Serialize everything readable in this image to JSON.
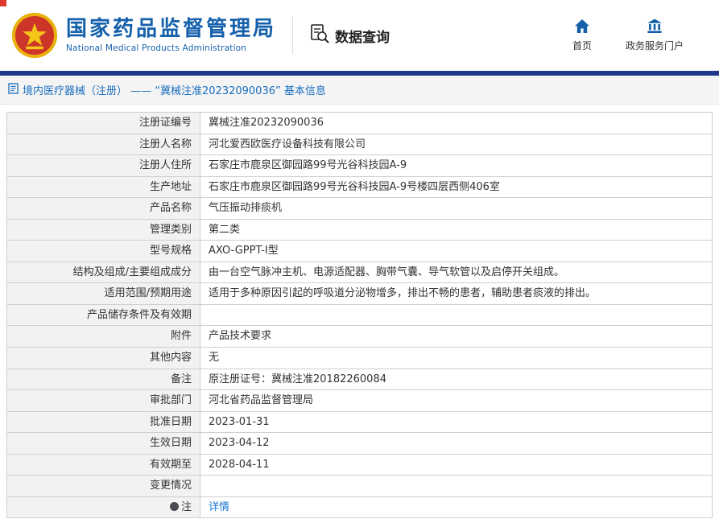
{
  "colors": {
    "primary_blue": "#1560ab",
    "accent_bar_blue": "#20388c",
    "link_blue": "#1a75d2",
    "label_bg": "#f2f2f2"
  },
  "header": {
    "org_name_cn": "国家药品监督管理局",
    "org_name_en": "National Medical Products Administration",
    "section_title": "数据查询",
    "nav": [
      {
        "label": "首页",
        "icon": "home-icon"
      },
      {
        "label": "政务服务门户",
        "icon": "government-portal-icon"
      }
    ]
  },
  "breadcrumb": {
    "icon": "document-icon",
    "text": "境内医疗器械（注册） —— “冀械注准20232090036” 基本信息"
  },
  "table": {
    "rows": [
      {
        "label": "注册证编号",
        "value": "冀械注准20232090036"
      },
      {
        "label": "注册人名称",
        "value": "河北爱西欧医疗设备科技有限公司"
      },
      {
        "label": "注册人住所",
        "value": "石家庄市鹿泉区御园路99号光谷科技园A-9"
      },
      {
        "label": "生产地址",
        "value": "石家庄市鹿泉区御园路99号光谷科技园A-9号楼四层西侧406室"
      },
      {
        "label": "产品名称",
        "value": "气压振动排痰机"
      },
      {
        "label": "管理类别",
        "value": "第二类"
      },
      {
        "label": "型号规格",
        "value": "AXO-GPPT-Ⅰ型"
      },
      {
        "label": "结构及组成/主要组成成分",
        "value": "由一台空气脉冲主机、电源适配器、胸带气囊、导气软管以及启停开关组成。"
      },
      {
        "label": "适用范围/预期用途",
        "value": "适用于多种原因引起的呼吸道分泌物增多，排出不畅的患者，辅助患者痰液的排出。"
      },
      {
        "label": "产品储存条件及有效期",
        "value": ""
      },
      {
        "label": "附件",
        "value": "产品技术要求"
      },
      {
        "label": "其他内容",
        "value": "无"
      },
      {
        "label": "备注",
        "value": "原注册证号：冀械注准20182260084"
      },
      {
        "label": "审批部门",
        "value": "河北省药品监督管理局"
      },
      {
        "label": "批准日期",
        "value": "2023-01-31"
      },
      {
        "label": "生效日期",
        "value": "2023-04-12"
      },
      {
        "label": "有效期至",
        "value": "2028-04-11"
      },
      {
        "label": "变更情况",
        "value": ""
      },
      {
        "label": "注",
        "value": "详情",
        "is_link": true,
        "has_bullet_icon": true
      }
    ]
  }
}
